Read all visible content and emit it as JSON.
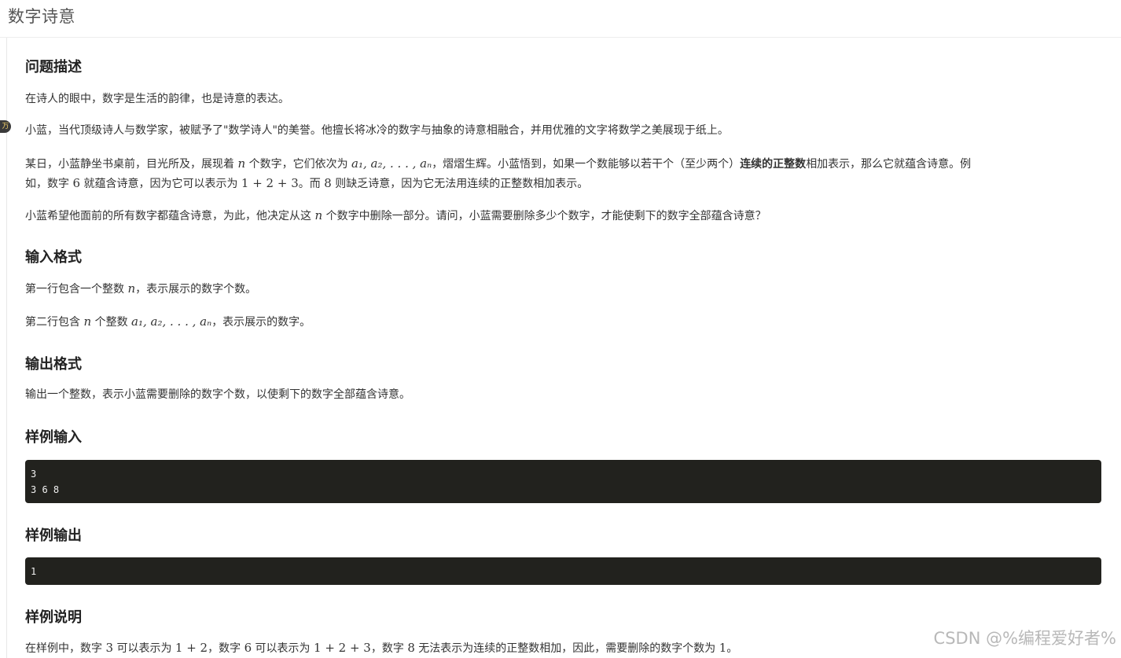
{
  "page": {
    "title": "数字诗意",
    "badge": "万"
  },
  "sections": {
    "description": {
      "heading": "问题描述",
      "p1": "在诗人的眼中，数字是生活的韵律，也是诗意的表达。",
      "p2": "小蓝，当代顶级诗人与数学家，被赋予了\"数学诗人\"的美誉。他擅长将冰冷的数字与抽象的诗意相融合，并用优雅的文字将数学之美展现于纸上。",
      "p3_a": "某日，小蓝静坐书桌前，目光所及，展现着 ",
      "p3_n": "n",
      "p3_b": " 个数字，它们依次为 ",
      "p3_seq": "a₁, a₂, . . . , aₙ",
      "p3_c": "，熠熠生辉。小蓝悟到，如果一个数能够以若干个（至少两个）",
      "p3_bold": "连续的正整数",
      "p3_d": "相加表示，那么它就蕴含诗意。例",
      "p3_e": "如，数字 ",
      "p3_six": "6",
      "p3_f": " 就蕴含诗意，因为它可以表示为 ",
      "p3_expr": "1 + 2 + 3",
      "p3_g": "。而 ",
      "p3_eight": "8",
      "p3_h": " 则缺乏诗意，因为它无法用连续的正整数相加表示。",
      "p4_a": "小蓝希望他面前的所有数字都蕴含诗意，为此，他决定从这 ",
      "p4_n": "n",
      "p4_b": " 个数字中删除一部分。请问，小蓝需要删除多少个数字，才能使剩下的数字全部蕴含诗意？"
    },
    "input": {
      "heading": "输入格式",
      "line1_a": "第一行包含一个整数 ",
      "line1_n": "n",
      "line1_b": "，表示展示的数字个数。",
      "line2_a": "第二行包含 ",
      "line2_n": "n",
      "line2_b": " 个整数 ",
      "line2_seq": "a₁, a₂, . . . , aₙ",
      "line2_c": "，表示展示的数字。"
    },
    "output": {
      "heading": "输出格式",
      "text": "输出一个整数，表示小蓝需要删除的数字个数，以使剩下的数字全部蕴含诗意。"
    },
    "sample_input": {
      "heading": "样例输入",
      "code": "3\n3 6 8"
    },
    "sample_output": {
      "heading": "样例输出",
      "code": "1"
    },
    "explanation": {
      "heading": "样例说明",
      "a": "在样例中，数字 ",
      "three": "3",
      "b": " 可以表示为 ",
      "expr1": "1 + 2",
      "c": "，数字 ",
      "six": "6",
      "d": " 可以表示为 ",
      "expr2": "1 + 2 + 3",
      "e": "，数字 ",
      "eight": "8",
      "f": " 无法表示为连续的正整数相加，因此，需要删除的数字个数为 ",
      "one": "1",
      "g": "。"
    }
  },
  "watermark": "CSDN @%编程爱好者%"
}
